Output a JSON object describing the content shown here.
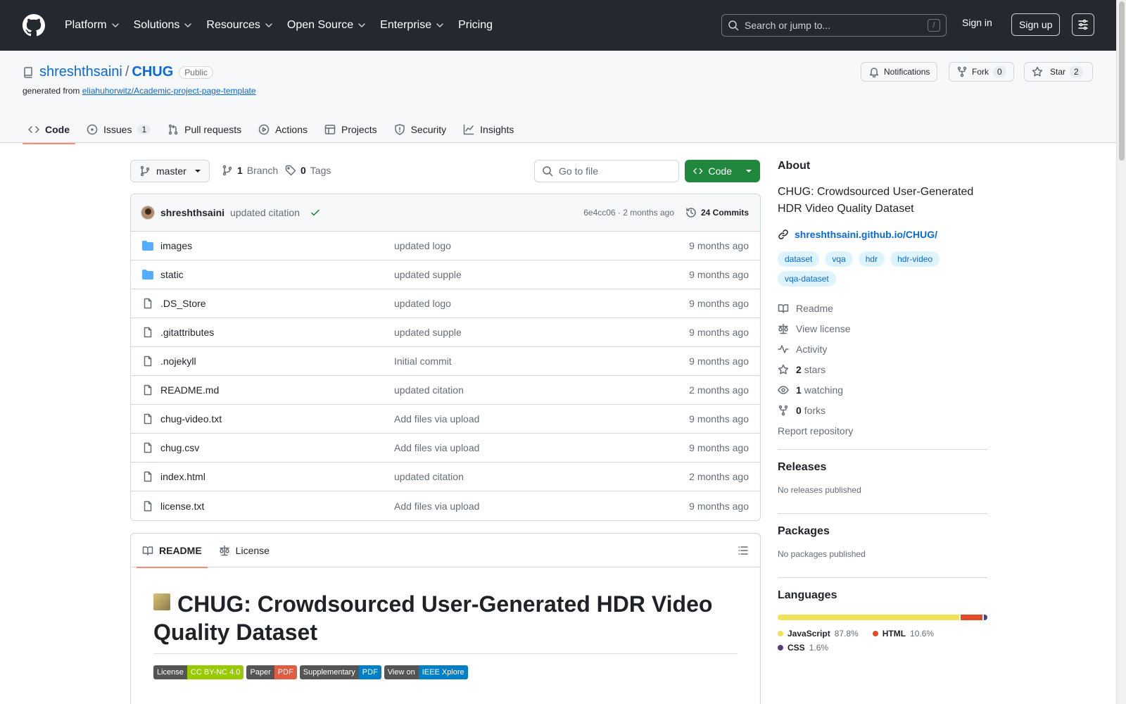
{
  "nav": {
    "items": [
      "Platform",
      "Solutions",
      "Resources",
      "Open Source",
      "Enterprise",
      "Pricing"
    ],
    "search_placeholder": "Search or jump to...",
    "slash": "/",
    "sign_in": "Sign in",
    "sign_up": "Sign up"
  },
  "repo": {
    "owner": "shreshthsaini",
    "name": "CHUG",
    "visibility": "Public",
    "generated_prefix": "generated from",
    "template": "eliahuhorwitz/Academic-project-page-template",
    "notifications": "Notifications",
    "fork": "Fork",
    "fork_count": "0",
    "star": "Star",
    "star_count": "2"
  },
  "tabs": [
    {
      "label": "Code",
      "icon": "code-icon"
    },
    {
      "label": "Issues",
      "count": "1",
      "icon": "issue-icon"
    },
    {
      "label": "Pull requests",
      "icon": "pull-request-icon"
    },
    {
      "label": "Actions",
      "icon": "play-icon"
    },
    {
      "label": "Projects",
      "icon": "table-icon"
    },
    {
      "label": "Security",
      "icon": "shield-icon"
    },
    {
      "label": "Insights",
      "icon": "graph-icon"
    }
  ],
  "toolbar": {
    "branch": "master",
    "branches_count": "1",
    "branches_label": "Branch",
    "tags_count": "0",
    "tags_label": "Tags",
    "go_to_file": "Go to file",
    "code_button": "Code"
  },
  "commit": {
    "author": "shreshthsaini",
    "message": "updated citation",
    "hash_time": "6e4cc06 · 2 months ago",
    "commits": "24 Commits"
  },
  "files": [
    {
      "name": "images",
      "type": "folder",
      "msg": "updated logo",
      "date": "9 months ago"
    },
    {
      "name": "static",
      "type": "folder",
      "msg": "updated supple",
      "date": "9 months ago"
    },
    {
      "name": ".DS_Store",
      "type": "file",
      "msg": "updated logo",
      "date": "9 months ago"
    },
    {
      "name": ".gitattributes",
      "type": "file",
      "msg": "updated supple",
      "date": "9 months ago"
    },
    {
      "name": ".nojekyll",
      "type": "file",
      "msg": "Initial commit",
      "date": "9 months ago"
    },
    {
      "name": "README.md",
      "type": "file",
      "msg": "updated citation",
      "date": "2 months ago"
    },
    {
      "name": "chug-video.txt",
      "type": "file",
      "msg": "Add files via upload",
      "date": "9 months ago"
    },
    {
      "name": "chug.csv",
      "type": "file",
      "msg": "Add files via upload",
      "date": "9 months ago"
    },
    {
      "name": "index.html",
      "type": "file",
      "msg": "updated citation",
      "date": "2 months ago"
    },
    {
      "name": "license.txt",
      "type": "file",
      "msg": "Add files via upload",
      "date": "9 months ago"
    }
  ],
  "readme": {
    "tab_readme": "README",
    "tab_license": "License",
    "heading": "CHUG: Crowdsourced User-Generated HDR Video Quality Dataset",
    "badges": [
      {
        "left": "License",
        "right": "CC BY-NC 4.0",
        "color": "#97ca00"
      },
      {
        "left": "Paper",
        "right": "PDF",
        "color": "#e05d44"
      },
      {
        "left": "Supplementary",
        "right": "PDF",
        "color": "#007ec6"
      },
      {
        "left": "View on",
        "right": "IEEE Xplore",
        "color": "#007ec6"
      }
    ]
  },
  "about": {
    "title": "About",
    "description": "CHUG: Crowdsourced User-Generated HDR Video Quality Dataset",
    "homepage": "shreshthsaini.github.io/CHUG/",
    "topics": [
      "dataset",
      "vqa",
      "hdr",
      "hdr-video",
      "vqa-dataset"
    ],
    "links": [
      {
        "label": "Readme",
        "icon": "book-icon"
      },
      {
        "label": "View license",
        "icon": "law-icon"
      },
      {
        "label": "Activity",
        "icon": "pulse-icon"
      },
      {
        "bold": "2",
        "label": "stars",
        "icon": "star-icon"
      },
      {
        "bold": "1",
        "label": "watching",
        "icon": "eye-icon"
      },
      {
        "bold": "0",
        "label": "forks",
        "icon": "fork-icon"
      }
    ],
    "report": "Report repository"
  },
  "releases": {
    "title": "Releases",
    "empty": "No releases published"
  },
  "packages": {
    "title": "Packages",
    "empty": "No packages published"
  },
  "languages": {
    "title": "Languages",
    "items": [
      {
        "name": "JavaScript",
        "percent": "87.8%",
        "value": 87.8,
        "color": "#f1e05a"
      },
      {
        "name": "HTML",
        "percent": "10.6%",
        "value": 10.6,
        "color": "#e34c26"
      },
      {
        "name": "CSS",
        "percent": "1.6%",
        "value": 1.6,
        "color": "#563d7c"
      }
    ]
  }
}
